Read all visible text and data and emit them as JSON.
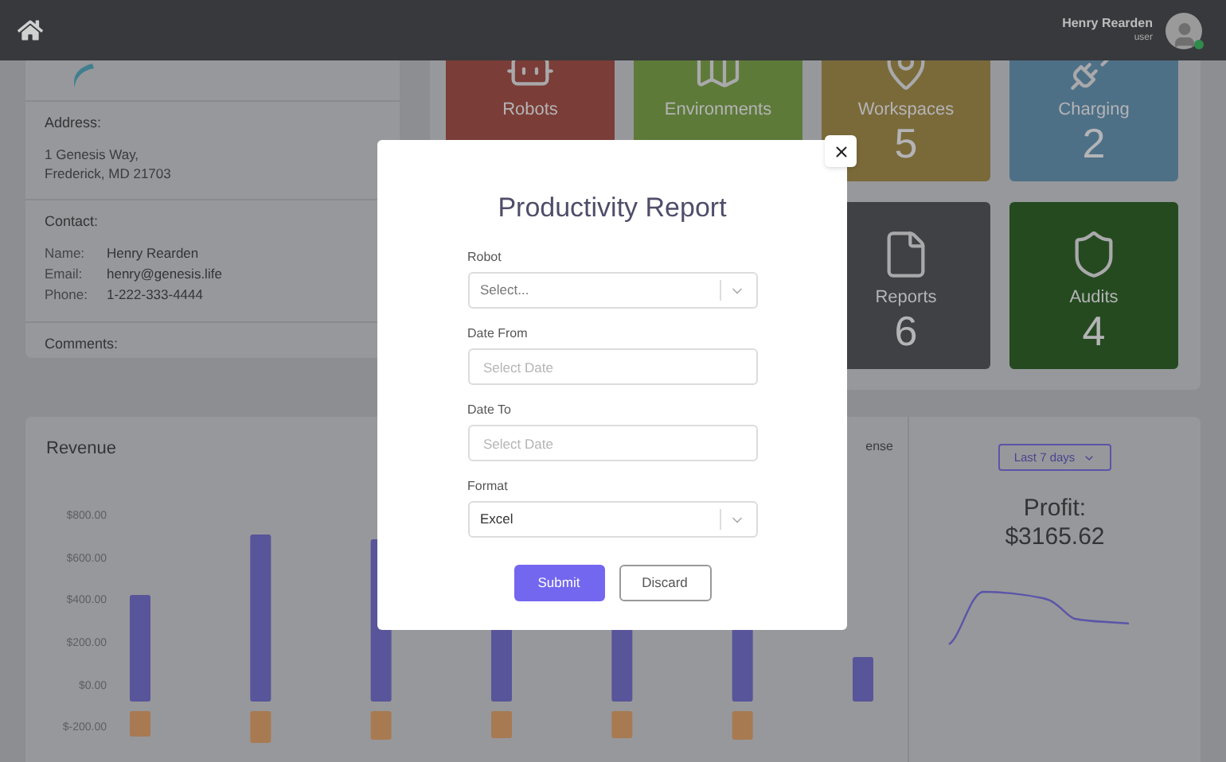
{
  "topbar": {
    "user": {
      "name": "Henry Rearden",
      "role": "user",
      "online": true
    }
  },
  "contact_card": {
    "address_label": "Address:",
    "address_lines": [
      "1 Genesis Way,",
      "Frederick, MD 21703"
    ],
    "contact_label": "Contact:",
    "contact_rows": [
      {
        "label": "Name:",
        "value": "Henry Rearden"
      },
      {
        "label": "Email:",
        "value": "henry@genesis.life"
      },
      {
        "label": "Phone:",
        "value": "1-222-333-4444"
      }
    ],
    "comments_label": "Comments:"
  },
  "tile_rows": [
    [
      {
        "kind": "robot",
        "label": "Robots",
        "color": "#7b3d37"
      },
      {
        "kind": "map",
        "label": "Environments",
        "color": "#5e7a39"
      },
      {
        "kind": "pin",
        "label": "Workspaces",
        "count": "5",
        "color": "#7a6a3a"
      },
      {
        "kind": "charging",
        "label": "Charging",
        "count": "2",
        "color": "#4e7087"
      }
    ],
    [
      {
        "kind": "file",
        "label": "Reports",
        "count": "6",
        "color": "#404145"
      },
      {
        "kind": "shield",
        "label": "Audits",
        "count": "4",
        "color": "#254a20"
      }
    ]
  ],
  "revenue": {
    "title": "Revenue",
    "legend_fragment": "ense",
    "axis_labels": [
      "$800.00",
      "$600.00",
      "$400.00",
      "$200.00",
      "$0.00",
      "$-200.00"
    ]
  },
  "profit": {
    "period": "Last 7 days",
    "label": "Profit:",
    "value": "$3165.62"
  },
  "modal": {
    "title": "Productivity Report",
    "fields": [
      {
        "kind": "select",
        "label": "Robot",
        "placeholder": "Select..."
      },
      {
        "kind": "date",
        "label": "Date From",
        "placeholder": "Select Date"
      },
      {
        "kind": "date",
        "label": "Date To",
        "placeholder": "Select Date"
      },
      {
        "kind": "select",
        "label": "Format",
        "value": "Excel"
      }
    ],
    "buttons": [
      {
        "kind": "primary",
        "label": "Submit"
      },
      {
        "kind": "secondary",
        "label": "Discard"
      }
    ]
  }
}
